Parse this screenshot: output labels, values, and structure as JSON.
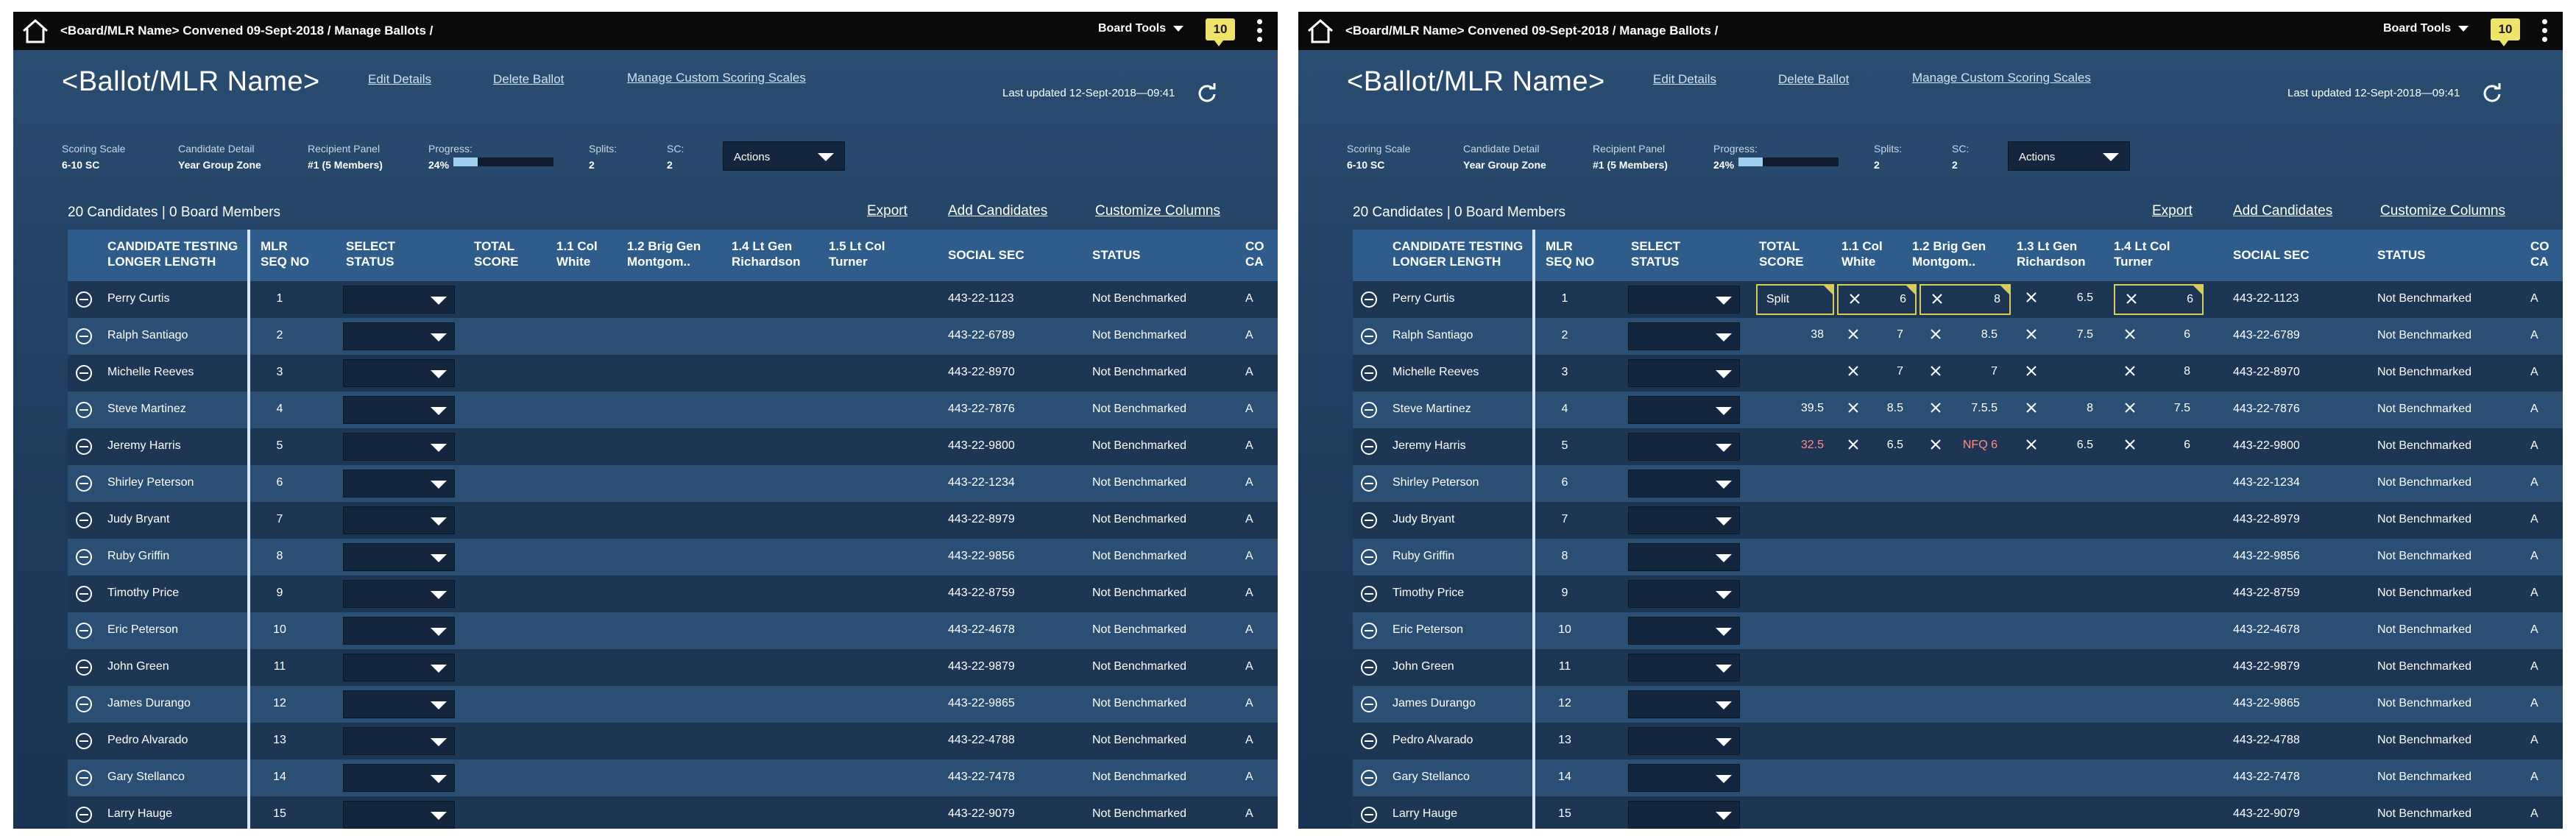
{
  "header": {
    "breadcrumb": "<Board/MLR Name> Convened 09-Sept-2018 / Manage Ballots /",
    "board_tools": "Board Tools",
    "notification_count": "10"
  },
  "page": {
    "title": "<Ballot/MLR Name>",
    "links": {
      "edit": "Edit Details",
      "delete": "Delete Ballot",
      "manage": "Manage Custom Scoring Scales"
    },
    "last_updated": "Last updated 12-Sept-2018—09:41"
  },
  "meta": {
    "scoring_scale_label": "Scoring Scale",
    "scoring_scale_value": "6-10 SC",
    "candidate_detail_label": "Candidate Detail",
    "candidate_detail_value": "Year Group Zone",
    "recipient_panel_label": "Recipient Panel",
    "recipient_panel_value": "#1 (5 Members)",
    "progress_label": "Progress:",
    "progress_value": "24%",
    "progress_fraction": 0.24,
    "splits_label": "Splits:",
    "splits_value": "2",
    "sc_label": "SC:",
    "sc_value": "2",
    "actions_label": "Actions"
  },
  "summary": {
    "counts": "20 Candidates | 0 Board Members",
    "export": "Export",
    "add_candidates": "Add Candidates",
    "customize_columns": "Customize Columns"
  },
  "left_columns": {
    "candidate": [
      "Candidate Testing",
      "Longer Length"
    ],
    "seq": [
      "MLR",
      "SEQ NO"
    ],
    "status_select": [
      "Select",
      "Status"
    ],
    "total": [
      "Total",
      "Score"
    ],
    "c1": [
      "1.1 Col",
      "White"
    ],
    "c2": [
      "1.2 Brig Gen",
      "Montgom.."
    ],
    "c3": [
      "1.4 Lt Gen",
      "Richardson"
    ],
    "c4": [
      "1.5 Lt Col",
      "Turner"
    ],
    "ssn": "Social Sec",
    "status": "Status",
    "cut": [
      "Co",
      "Ca"
    ]
  },
  "right_columns": {
    "candidate": [
      "Candidate Testing",
      "Longer Length"
    ],
    "seq": [
      "MLR",
      "SEQ NO"
    ],
    "status_select": [
      "Select",
      "Status"
    ],
    "total": [
      "Total",
      "Score"
    ],
    "c1": [
      "1.1 Col",
      "White"
    ],
    "c2": [
      "1.2 Brig Gen",
      "Montgom.."
    ],
    "c3": [
      "1.3 Lt Gen",
      "Richardson"
    ],
    "c4": [
      "1.4 Lt Col",
      "Turner"
    ],
    "ssn": "Social Sec",
    "status": "Status",
    "cut": [
      "Co",
      "Ca"
    ]
  },
  "rows": [
    {
      "name": "Perry Curtis",
      "seq": "1",
      "ssn": "443-22-1123",
      "status": "Not Benchmarked",
      "cut": "A"
    },
    {
      "name": "Ralph Santiago",
      "seq": "2",
      "ssn": "443-22-6789",
      "status": "Not Benchmarked",
      "cut": "A"
    },
    {
      "name": "Michelle Reeves",
      "seq": "3",
      "ssn": "443-22-8970",
      "status": "Not Benchmarked",
      "cut": "A"
    },
    {
      "name": "Steve Martinez",
      "seq": "4",
      "ssn": "443-22-7876",
      "status": "Not Benchmarked",
      "cut": "A"
    },
    {
      "name": "Jeremy Harris",
      "seq": "5",
      "ssn": "443-22-9800",
      "status": "Not Benchmarked",
      "cut": "A"
    },
    {
      "name": "Shirley Peterson",
      "seq": "6",
      "ssn": "443-22-1234",
      "status": "Not Benchmarked",
      "cut": "A"
    },
    {
      "name": "Judy Bryant",
      "seq": "7",
      "ssn": "443-22-8979",
      "status": "Not Benchmarked",
      "cut": "A"
    },
    {
      "name": "Ruby Griffin",
      "seq": "8",
      "ssn": "443-22-9856",
      "status": "Not Benchmarked",
      "cut": "A"
    },
    {
      "name": "Timothy Price",
      "seq": "9",
      "ssn": "443-22-8759",
      "status": "Not Benchmarked",
      "cut": "A"
    },
    {
      "name": "Eric Peterson",
      "seq": "10",
      "ssn": "443-22-4678",
      "status": "Not Benchmarked",
      "cut": "A"
    },
    {
      "name": "John Green",
      "seq": "11",
      "ssn": "443-22-9879",
      "status": "Not Benchmarked",
      "cut": "A"
    },
    {
      "name": "James Durango",
      "seq": "12",
      "ssn": "443-22-9865",
      "status": "Not Benchmarked",
      "cut": "A"
    },
    {
      "name": "Pedro Alvarado",
      "seq": "13",
      "ssn": "443-22-4788",
      "status": "Not Benchmarked",
      "cut": "A"
    },
    {
      "name": "Gary Stellanco",
      "seq": "14",
      "ssn": "443-22-7478",
      "status": "Not Benchmarked",
      "cut": "A"
    },
    {
      "name": "Larry Hauge",
      "seq": "15",
      "ssn": "443-22-9079",
      "status": "Not Benchmarked",
      "cut": "A"
    }
  ],
  "scores": [
    {
      "total": "Split",
      "total_red": false,
      "c1": "6",
      "c2": "8",
      "c3": "6.5",
      "c4": "6",
      "flag_total": true,
      "flag_c1": true,
      "flag_c2": true,
      "flag_c3": false,
      "flag_c4": true,
      "x_c1": true,
      "x_c2": true,
      "x_c3": true,
      "x_c4": true,
      "c2_red": false
    },
    {
      "total": "38",
      "total_red": false,
      "c1": "7",
      "c2": "8.5",
      "c3": "7.5",
      "c4": "6",
      "flag_total": false,
      "flag_c1": false,
      "flag_c2": false,
      "flag_c3": false,
      "flag_c4": false,
      "x_c1": true,
      "x_c2": true,
      "x_c3": true,
      "x_c4": true,
      "c2_red": false
    },
    {
      "total": "",
      "total_red": false,
      "c1": "7",
      "c2": "7",
      "c3": "",
      "c4": "8",
      "flag_total": false,
      "flag_c1": false,
      "flag_c2": false,
      "flag_c3": false,
      "flag_c4": false,
      "x_c1": true,
      "x_c2": true,
      "x_c3": true,
      "x_c4": true,
      "c2_red": false
    },
    {
      "total": "39.5",
      "total_red": false,
      "c1": "8.5",
      "c2": "7.5.5",
      "c3": "8",
      "c4": "7.5",
      "flag_total": false,
      "flag_c1": false,
      "flag_c2": false,
      "flag_c3": false,
      "flag_c4": false,
      "x_c1": true,
      "x_c2": true,
      "x_c3": true,
      "x_c4": true,
      "c2_red": false
    },
    {
      "total": "32.5",
      "total_red": true,
      "c1": "6.5",
      "c2": "NFQ 6",
      "c3": "6.5",
      "c4": "6",
      "flag_total": false,
      "flag_c1": false,
      "flag_c2": false,
      "flag_c3": false,
      "flag_c4": false,
      "x_c1": true,
      "x_c2": true,
      "x_c3": true,
      "x_c4": true,
      "c2_red": true
    }
  ],
  "colors": {
    "accent_yellow": "#d9cb58",
    "negative_red": "#ff8c8c",
    "header_row": "#2f5d8b",
    "progress": "#9fd0f0"
  },
  "icons": {
    "home": "home-icon",
    "refresh": "refresh-icon",
    "remove": "minus-circle-icon",
    "clear": "close-icon",
    "dropdown": "chevron-down-icon",
    "menu": "kebab-menu-icon"
  }
}
